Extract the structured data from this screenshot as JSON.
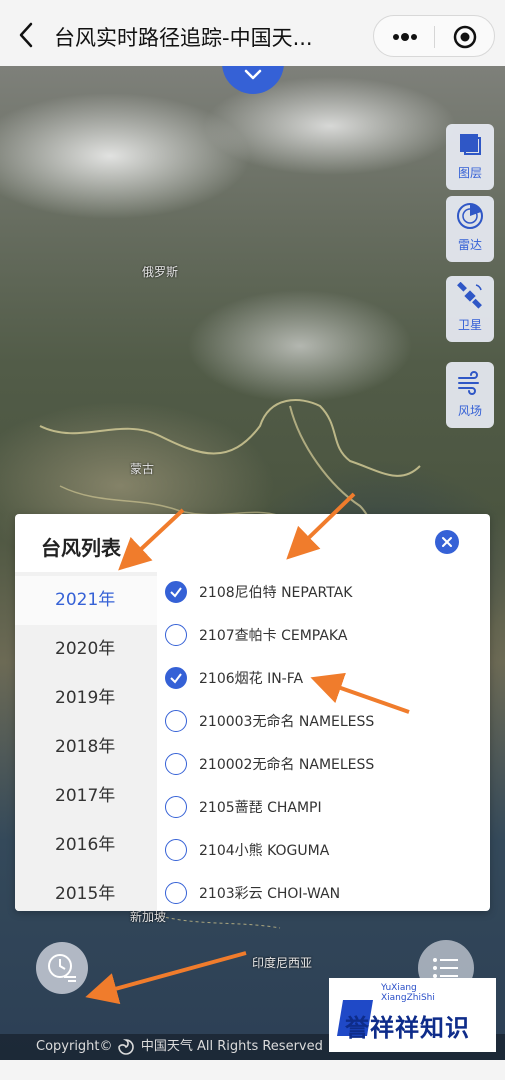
{
  "nav": {
    "back_icon": "chevron-left-icon",
    "title": "台风实时路径追踪-中国天...",
    "more_icon": "more-dots-icon",
    "target_icon": "record-target-icon"
  },
  "map": {
    "labels": {
      "russia": "俄罗斯",
      "mongolia": "蒙古",
      "indonesia": "印度尼西亚",
      "mongolia_region": "",
      "malaysia": "新加坡"
    },
    "controls": {
      "layers": "图层",
      "radar": "雷达",
      "satellite": "卫星",
      "wind": "风场"
    },
    "copyright_prefix": "Copyright©",
    "copyright_brand": "中国天气",
    "copyright_suffix": "All Rights Reserved",
    "collapse_icon": "chevron-down-icon"
  },
  "panel": {
    "title": "台风列表",
    "years": [
      "2021年",
      "2020年",
      "2019年",
      "2018年",
      "2017年",
      "2016年",
      "2015年"
    ],
    "active_year": "2021年",
    "storms": [
      {
        "label": "2108尼伯特 NEPARTAK",
        "checked": true
      },
      {
        "label": "2107查帕卡 CEMPAKA",
        "checked": false
      },
      {
        "label": "2106烟花 IN-FA",
        "checked": true
      },
      {
        "label": "210003无命名 NAMELESS",
        "checked": false
      },
      {
        "label": "210002无命名 NAMELESS",
        "checked": false
      },
      {
        "label": "2105蔷琵 CHAMPI",
        "checked": false
      },
      {
        "label": "2104小熊 KOGUMA",
        "checked": false
      },
      {
        "label": "2103彩云 CHOI-WAN",
        "checked": false
      }
    ]
  },
  "watermark": {
    "pinyin_line1": "YuXiang",
    "pinyin_line2": "XiangZhiShi",
    "text": "誉祥祥知识"
  },
  "colors": {
    "accent": "#3561d6",
    "arrow": "#f07c2c"
  }
}
